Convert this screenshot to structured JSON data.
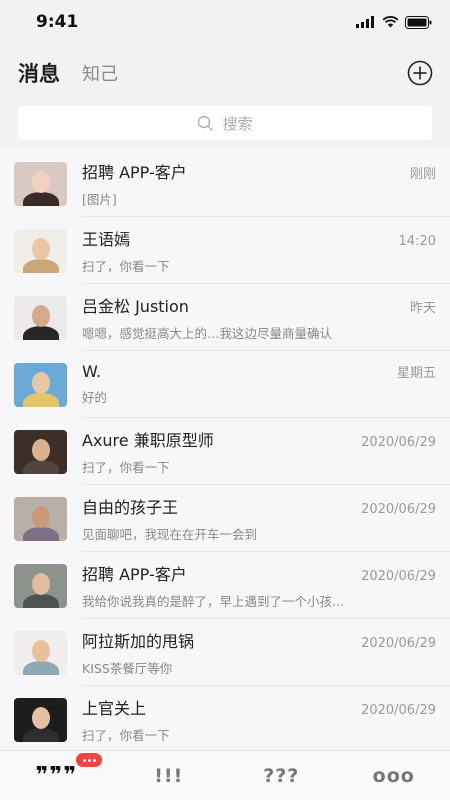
{
  "status": {
    "time": "9:41"
  },
  "header": {
    "tab_active": "消息",
    "tab_inactive": "知己"
  },
  "search": {
    "placeholder": "搜索"
  },
  "conversations": [
    {
      "name": "招聘 APP-客户",
      "time": "刚刚",
      "preview": "[图片]",
      "avatar_bg": "#d9c9c3",
      "avatar_head": "#f1d2c2",
      "avatar_body": "#3a2b2b"
    },
    {
      "name": "王语嫣",
      "time": "14:20",
      "preview": "扫了，你看一下",
      "avatar_bg": "#f0ece8",
      "avatar_head": "#e9c7a4",
      "avatar_body": "#c9a779"
    },
    {
      "name": "吕金松 Justion",
      "time": "昨天",
      "preview": "嗯嗯，感觉挺高大上的…我这边尽量商量确认",
      "avatar_bg": "#ece9ea",
      "avatar_head": "#d4a98e",
      "avatar_body": "#262626"
    },
    {
      "name": "W.",
      "time": "星期五",
      "preview": "好的",
      "avatar_bg": "#6aa9d8",
      "avatar_head": "#e8c8a3",
      "avatar_body": "#e6c566"
    },
    {
      "name": "Axure  兼职原型师",
      "time": "2020/06/29",
      "preview": "扫了，你看一下",
      "avatar_bg": "#3b2f27",
      "avatar_head": "#dcb192",
      "avatar_body": "#51463d"
    },
    {
      "name": "自由的孩子王",
      "time": "2020/06/29",
      "preview": "见面聊吧，我现在在开车一会到",
      "avatar_bg": "#b8b0a6",
      "avatar_head": "#c99a7a",
      "avatar_body": "#7d6f86"
    },
    {
      "name": "招聘 APP-客户",
      "time": "2020/06/29",
      "preview": "我给你说我真的是醉了，早上遇到了一个小孩…",
      "avatar_bg": "#8d938c",
      "avatar_head": "#e1bda0",
      "avatar_body": "#4f5252"
    },
    {
      "name": "阿拉斯加的甩锅",
      "time": "2020/06/29",
      "preview": "KISS茶餐厅等你",
      "avatar_bg": "#efeeec",
      "avatar_head": "#e7c09c",
      "avatar_body": "#8fa8b4"
    },
    {
      "name": "上官关上",
      "time": "2020/06/29",
      "preview": "扫了，你看一下",
      "avatar_bg": "#1d1d1d",
      "avatar_head": "#e3bfa4",
      "avatar_body": "#2e2e2e"
    }
  ],
  "tabbar": [
    {
      "label": "❞❞❞",
      "active": true
    },
    {
      "label": "!!!",
      "active": false
    },
    {
      "label": "???",
      "active": false
    },
    {
      "label": "ooo",
      "active": false
    }
  ],
  "colors": {
    "badge": "#f0443c",
    "accent": "#222222"
  }
}
